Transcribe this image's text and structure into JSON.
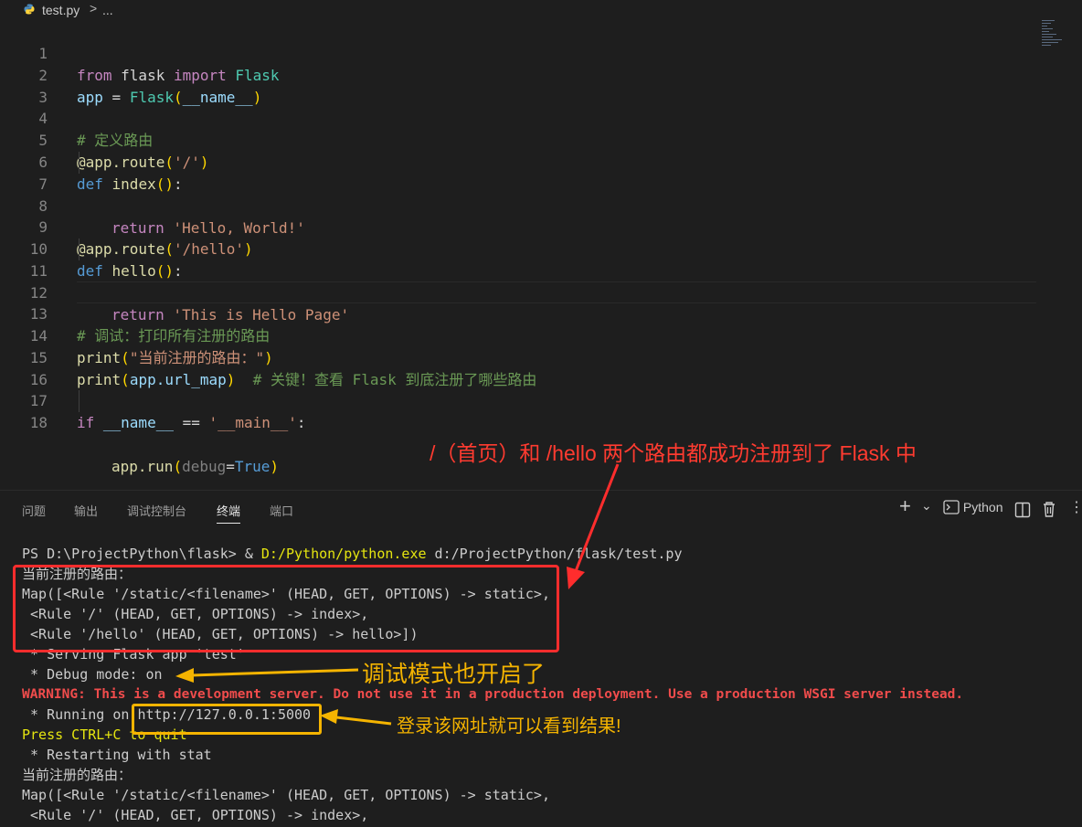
{
  "breadcrumb": {
    "file": "test.py",
    "separator": ">",
    "more": "..."
  },
  "editor": {
    "lines": [
      {
        "n": "1"
      },
      {
        "n": "2"
      },
      {
        "n": "3"
      },
      {
        "n": "4"
      },
      {
        "n": "5"
      },
      {
        "n": "6"
      },
      {
        "n": "7"
      },
      {
        "n": "8"
      },
      {
        "n": "9"
      },
      {
        "n": "10"
      },
      {
        "n": "11"
      },
      {
        "n": "12"
      },
      {
        "n": "13"
      },
      {
        "n": "14"
      },
      {
        "n": "15"
      },
      {
        "n": "16"
      },
      {
        "n": "17"
      },
      {
        "n": "18"
      }
    ],
    "t": {
      "from": "from",
      "flask": " flask ",
      "import": "import",
      "Flask": " Flask",
      "app": "app",
      "eq": " = ",
      "Flask2": "Flask",
      "po": "(",
      "name": "__name__",
      "pc": ")",
      "c4": "# 定义路由",
      "at": "@app.route",
      "s_root": "'/'",
      "def": "def",
      "index": " index",
      "paren": "()",
      "colon": ":",
      "ret": "return",
      "s_hw": " 'Hello, World!'",
      "s_hello": "'/hello'",
      "hello": " hello",
      "s_page": " 'This is Hello Page'",
      "c13": "# 调试：打印所有注册的路由",
      "print": "print",
      "s14": "\"当前注册的路由：\"",
      "urlmap": "app.url_map",
      "c15": "  # 关键！查看 Flask 到底注册了哪些路由",
      "if": "if",
      "nm": " __name__ ",
      "eqeq": "== ",
      "s_main": "'__main__'",
      "run": "app.run",
      "debug": "debug",
      "true": "True"
    }
  },
  "annotations": {
    "routes_note": "/（首页）和 /hello 两个路由都成功注册到了 Flask 中",
    "debug_note": "调试模式也开启了",
    "url_note": "登录该网址就可以看到结果!"
  },
  "panel": {
    "tabs": [
      "问题",
      "输出",
      "调试控制台",
      "终端",
      "端口"
    ],
    "active_tab": "终端",
    "add_icon": "+",
    "dropdown_icon": "⌄",
    "python_label": "Python",
    "split_icon": "split-icon",
    "trash_icon": "trash-icon",
    "more_icon": "⋮"
  },
  "terminal": {
    "prompt": "PS D:\\ProjectPython\\flask> & ",
    "exe": "D:/Python/python.exe",
    "script": " d:/ProjectPython/flask/test.py",
    "l2": "当前注册的路由：",
    "l3": "Map([<Rule '/static/<filename>' (HEAD, GET, OPTIONS) -> static>,",
    "l4": " <Rule '/' (HEAD, GET, OPTIONS) -> index>,",
    "l5": " <Rule '/hello' (HEAD, GET, OPTIONS) -> hello>])",
    "l6": " * Serving Flask app 'test'",
    "l7": " * Debug mode: on",
    "l8": "WARNING: This is a development server. Do not use it in a production deployment. Use a production WSGI server instead.",
    "l9a": " * Running on ",
    "l9b": "http://127.0.0.1:5000",
    "l10": "Press CTRL+C to quit",
    "l11": " * Restarting with stat",
    "l12": "当前注册的路由：",
    "l13": "Map([<Rule '/static/<filename>' (HEAD, GET, OPTIONS) -> static>,",
    "l14": " <Rule '/' (HEAD, GET, OPTIONS) -> index>,"
  },
  "colors": {
    "red_annotation": "#ff3b30",
    "yellow_annotation": "#f5b400",
    "terminal_warning": "#f14c4c",
    "terminal_yellow": "#e5e510"
  }
}
